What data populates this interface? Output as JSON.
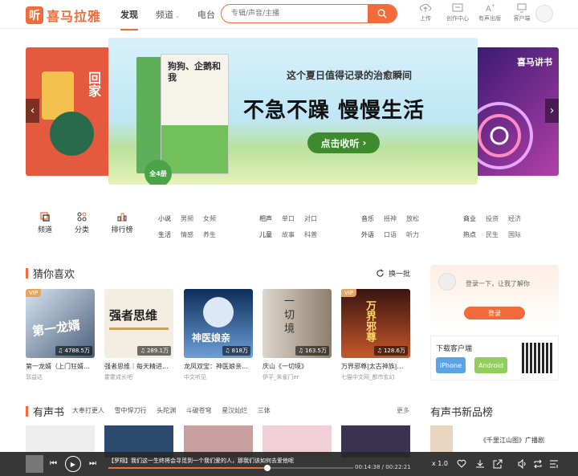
{
  "header": {
    "logo_badge": "听",
    "logo_text": "喜马拉雅",
    "nav": [
      "发现",
      "频道",
      "电台"
    ],
    "search_placeholder": "专辑/声音/主播",
    "tools": [
      "上传",
      "创作中心",
      "有声出版",
      "客户端"
    ]
  },
  "banner": {
    "left_book_title": "回家",
    "main_title": "这个夏日值得记录的治愈瞬间",
    "slogan": "不急不躁 慢慢生活",
    "button": "点击收听",
    "book_title": "狗狗、企鹅和我",
    "book_badge": "全4册",
    "right_title": "喜马讲书"
  },
  "categories": {
    "icons": [
      "频道",
      "分类",
      "排行榜"
    ],
    "groups": [
      [
        [
          "小说",
          "男频",
          "女频"
        ],
        [
          "生活",
          "情感",
          "养生"
        ]
      ],
      [
        [
          "相声",
          "单口",
          "对口"
        ],
        [
          "儿童",
          "故事",
          "科普"
        ]
      ],
      [
        [
          "音乐",
          "摇神",
          "放松"
        ],
        [
          "外语",
          "口语",
          "听力"
        ]
      ],
      [
        [
          "商业",
          "投资",
          "经济"
        ],
        [
          "热点",
          "民生",
          "国际"
        ]
      ]
    ]
  },
  "guess": {
    "title": "猜你喜欢",
    "refresh": "换一批",
    "cards": [
      {
        "vip": "VIP",
        "count": "4788.5万",
        "title": "第一龙婿（上门狂婿…",
        "author": "郭益达",
        "cover_text": "第一龙婿"
      },
      {
        "vip": "",
        "count": "289.1万",
        "title": "强者思维｜每天精进…",
        "author": "霍霍成长吧",
        "cover_text": "强者思维"
      },
      {
        "vip": "",
        "count": "818万",
        "title": "龙凤双宝：神医娘亲…",
        "author": "中文听见",
        "cover_text": "神医娘亲"
      },
      {
        "vip": "",
        "count": "163.5万",
        "title": "庆山《一切境》",
        "author": "伊平_朱雀门er",
        "cover_text": "一切境"
      },
      {
        "vip": "VIP",
        "count": "128.6万",
        "title": "万界邪尊|太古神族|…",
        "author": "七猫中文网_都市玄幻",
        "cover_text": "万界邪尊"
      }
    ]
  },
  "login": {
    "text": "登录一下，让我了解你",
    "button": "登录"
  },
  "download": {
    "title": "下载客户端",
    "ios": "iPhone",
    "android": "Android"
  },
  "audiobooks": {
    "title": "有声书",
    "tabs": [
      "大奉打更人",
      "雪中悍刀行",
      "头陀渊",
      "斗破苍穹",
      "星汉灿烂",
      "三体"
    ],
    "more": "更多"
  },
  "rank": {
    "title": "有声书新品榜",
    "item": "《千里江山图》广播剧"
  },
  "player": {
    "title": "【罗翔】我们这一生终将会寻觅到一个我们爱的人，那我们该如何去爱他呢",
    "current": "00:14:38",
    "total": "00:22:21",
    "speed": "x 1.0",
    "progress": 0.65
  },
  "colors": {
    "accent": "#f26b3a"
  }
}
